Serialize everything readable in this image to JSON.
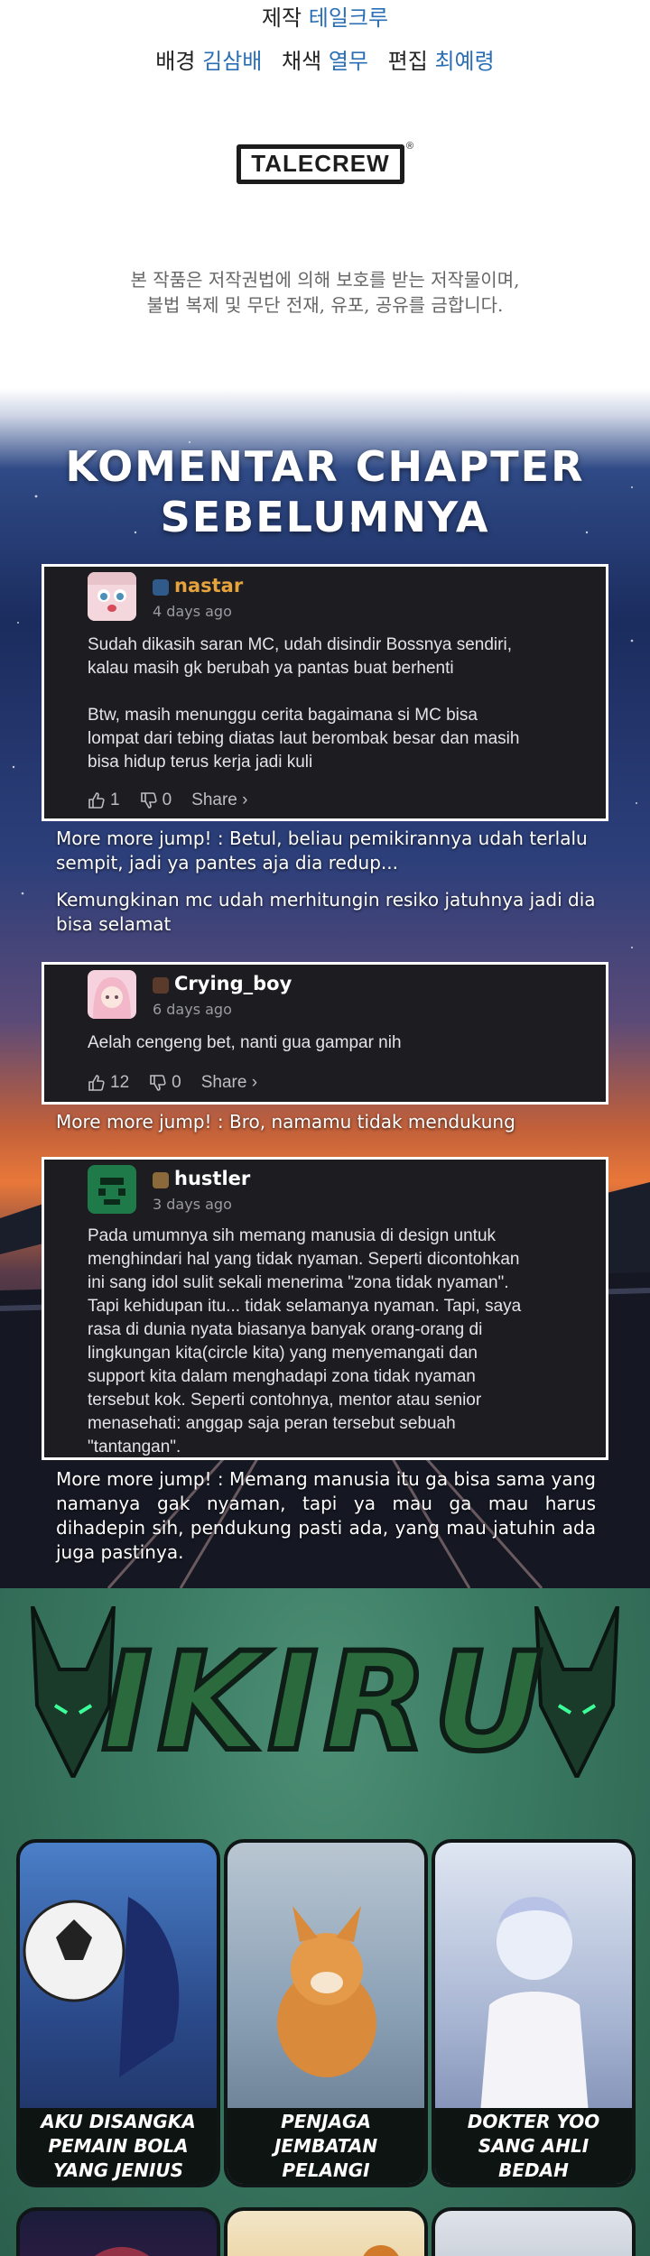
{
  "credits": {
    "line1": {
      "role1": "제작",
      "name1": "테일크루"
    },
    "line2": {
      "role1": "배경",
      "name1": "김삼배",
      "role2": "채색",
      "name2": "열무",
      "role3": "편집",
      "name3": "최예령"
    },
    "logo_text": "TALECREW",
    "logo_mark": "®",
    "copyright_line1": "본 작품은 저작권법에 의해 보호를 받는 저작물이며,",
    "copyright_line2": "불법 복제 및 무단 전재, 유포, 공유를 금합니다."
  },
  "comments": {
    "title_line1": "KOMENTAR CHAPTER",
    "title_line2": "SEBELUMNYA",
    "items": [
      {
        "username": "nastar",
        "date": "4 days ago",
        "body": "Sudah dikasih saran MC, udah disindir Bossnya sendiri,\nkalau masih gk berubah ya pantas buat berhenti\n\nBtw, masih menunggu cerita bagaimana si MC bisa\nlompat dari tebing diatas laut berombak besar dan masih\nbisa hidup terus kerja jadi kuli",
        "likes": "1",
        "dislikes": "0",
        "share": "Share ›",
        "username_color": "#e6a23c"
      },
      {
        "username": "Crying_boy",
        "date": "6 days ago",
        "body": "Aelah cengeng bet, nanti gua gampar nih",
        "likes": "12",
        "dislikes": "0",
        "share": "Share ›",
        "username_color": "#ffffff"
      },
      {
        "username": "hustler",
        "date": "3 days ago",
        "body": "Pada umumnya sih memang manusia di design untuk\nmenghindari hal yang tidak nyaman. Seperti dicontohkan\nini sang idol sulit sekali menerima \"zona tidak nyaman\".\nTapi kehidupan itu... tidak selamanya nyaman. Tapi, saya\nrasa di dunia nyata biasanya banyak orang-orang di\nlingkungan kita(circle kita) yang menyemangati dan\nsupport kita dalam menghadapi zona tidak nyaman\ntersebut kok. Seperti contohnya, mentor atau senior\nmenasehati: anggap saja peran tersebut sebuah\n\"tantangan\".",
        "username_color": "#ffffff"
      }
    ],
    "replies": {
      "r1": "More more jump! : Betul, beliau pemikirannya udah terlalu sempit, jadi ya pantes aja dia redup...",
      "r2": "Kemungkinan mc udah merhitungin resiko jatuhnya jadi dia bisa selamat",
      "r3": "More more jump! : Bro, namamu tidak mendukung",
      "r4": "More more jump! : Memang manusia itu ga bisa sama yang namanya gak nyaman, tapi ya mau ga mau harus dihadepin sih, pendukung pasti ada, yang mau jatuhin ada juga pastinya."
    }
  },
  "promo": {
    "brand": "IKIRU",
    "titles": [
      "AKU DISANGKA PEMAIN BOLA YANG JENIUS",
      "PENJAGA JEMBATAN PELANGI",
      "DOKTER YOO SANG AHLI BEDAH"
    ],
    "colors": {
      "brand_green": "#2a6a3d",
      "background": "#3a7a63"
    }
  }
}
